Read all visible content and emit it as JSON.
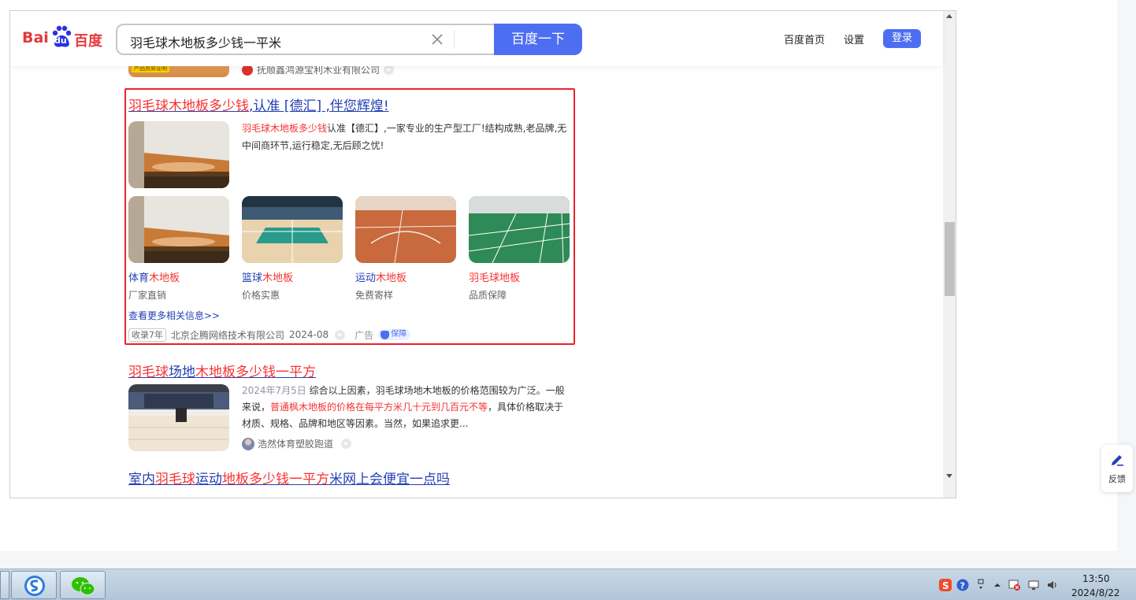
{
  "header": {
    "search_query": "羽毛球木地板多少钱一平米",
    "search_button": "百度一下",
    "nav_home": "百度首页",
    "nav_settings": "设置",
    "login": "登录",
    "logo_text_bai": "Bai",
    "logo_text_du": "du",
    "logo_text_cn": "百度"
  },
  "prev_result": {
    "badge_text": "产品资质证明",
    "source": "抚顺鑫鸿源宝利木业有限公司"
  },
  "ad_result": {
    "title_red": "羽毛球木地板多少钱",
    "title_rest": ",认准 [德汇] ,伴您辉煌!",
    "desc_red": "羽毛球木地板多少钱",
    "desc_rest": "认准【德汇】,一家专业的生产型工厂!结构成熟,老品牌,无中间商环节,运行稳定,无后顾之忧!",
    "items": [
      {
        "cap_blue": "体育",
        "cap_red": "木地板",
        "sub": "厂家直销"
      },
      {
        "cap_blue": "篮球",
        "cap_red": "木地板",
        "sub": "价格实惠"
      },
      {
        "cap_blue": "运动",
        "cap_red": "木地板",
        "sub": "免费寄样"
      },
      {
        "cap_blue": "",
        "cap_red": "羽毛球地板",
        "sub": "品质保障"
      }
    ],
    "more_link": "查看更多相关信息>>",
    "tag": "收录7年",
    "company": "北京企腾网络技术有限公司",
    "date": "2024-08",
    "ad_label": "广告",
    "guard_label": "保障"
  },
  "result2": {
    "title_red1": "羽毛球",
    "title_blue1": "场地",
    "title_red2": "木地板多少钱一平方",
    "date": "2024年7月5日",
    "desc_a": " 综合以上因素，羽毛球场地木地板的价格范围较为广泛。一般来说，",
    "desc_red": "普通枫木地板的价格在每平方米几十元到几百元不等",
    "desc_b": "，具体价格取决于材质、规格、品牌和地区等因素。当然，如果追求更...",
    "source": "浩然体育塑胶跑道"
  },
  "result3": {
    "title_blue1": "室内",
    "title_red1": "羽毛球",
    "title_blue2": "运动",
    "title_red2": "地板多少钱一平方",
    "title_blue3": "米网上会便宜一点吗"
  },
  "feedback": {
    "label": "反馈"
  },
  "taskbar": {
    "time": "13:50",
    "date": "2024/8/22",
    "apps": [
      "sogou-browser-icon",
      "wechat-icon"
    ]
  },
  "colors": {
    "brand_blue": "#4e6ef2",
    "link_blue": "#2440b3",
    "highlight_red": "#f73131",
    "ad_border": "#e8242c"
  }
}
